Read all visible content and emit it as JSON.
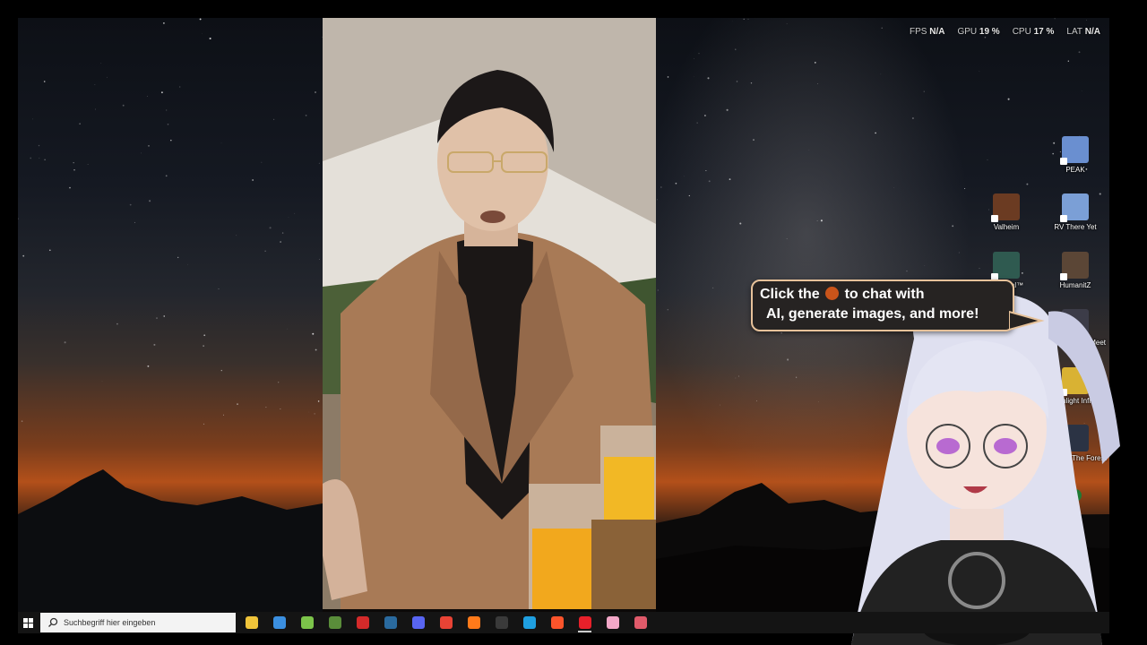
{
  "overlay": {
    "stats": [
      {
        "label": "FPS",
        "value": "N/A"
      },
      {
        "label": "GPU",
        "value": "19 %"
      },
      {
        "label": "CPU",
        "value": "17 %"
      },
      {
        "label": "LAT",
        "value": "N/A"
      }
    ]
  },
  "desktop_icons": [
    {
      "label": "PEAK",
      "color": "#6a8fd0"
    },
    {
      "label": "Valheim",
      "color": "#6b3b22"
    },
    {
      "label": "RV There Yet",
      "color": "#7b9fd6"
    },
    {
      "label": "Returnal™",
      "color": "#2f5a50"
    },
    {
      "label": "HumanitZ",
      "color": "#5b4636"
    },
    {
      "label": "Where Winds Meet",
      "color": "#3c3c48"
    },
    {
      "label": "Torchlight Infinite",
      "color": "#d9b233"
    },
    {
      "label": "Sons Of The Forest",
      "color": "#2b3344"
    },
    {
      "label": "",
      "color": "#1f7a33"
    }
  ],
  "promo": {
    "line1_prefix": "Click the",
    "line1_suffix": "to chat with",
    "line2": "AI, generate images, and more!"
  },
  "taskbar": {
    "search_placeholder": "Suchbegriff hier eingeben",
    "apps": [
      {
        "name": "file-explorer",
        "color": "#f0c43a",
        "active": false
      },
      {
        "name": "calculator",
        "color": "#3b8fe0",
        "active": false
      },
      {
        "name": "android",
        "color": "#7cc44a",
        "active": false
      },
      {
        "name": "minecraft",
        "color": "#5a8d3a",
        "active": false
      },
      {
        "name": "red-app",
        "color": "#d42a2a",
        "active": false
      },
      {
        "name": "steam",
        "color": "#2a6a9e",
        "active": false
      },
      {
        "name": "discord",
        "color": "#5865f2",
        "active": false
      },
      {
        "name": "chrome",
        "color": "#e84335",
        "active": false
      },
      {
        "name": "firefox",
        "color": "#ff7a1a",
        "active": false
      },
      {
        "name": "obs",
        "color": "#3a3a3a",
        "active": false
      },
      {
        "name": "battle-net",
        "color": "#1f9fe0",
        "active": false
      },
      {
        "name": "brave",
        "color": "#fb542b",
        "active": false
      },
      {
        "name": "opera",
        "color": "#e8202a",
        "active": true
      },
      {
        "name": "pink-app",
        "color": "#f3a8c8",
        "active": false
      },
      {
        "name": "tool-app",
        "color": "#e05a6a",
        "active": false
      }
    ]
  },
  "colors": {
    "bubble_border": "#e7c29a",
    "accent_orange": "#c9541a",
    "vtuber_hair": "#dfe0f0"
  }
}
